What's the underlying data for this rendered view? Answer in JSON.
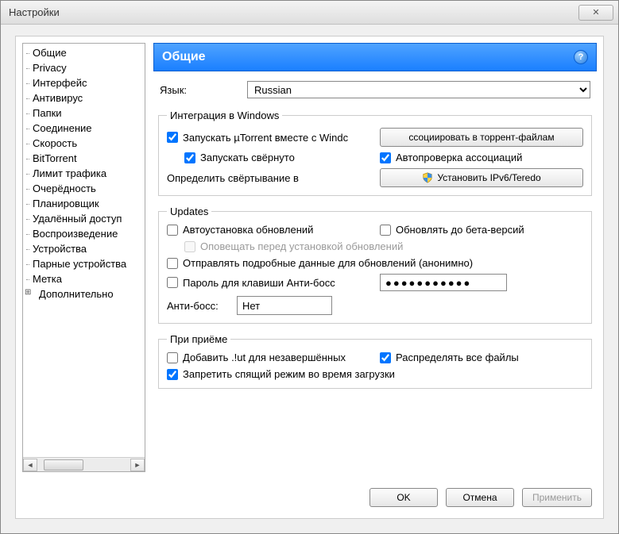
{
  "window": {
    "title": "Настройки"
  },
  "sidebar": {
    "items": [
      {
        "label": "Общие",
        "selected": true
      },
      {
        "label": "Privacy"
      },
      {
        "label": "Интерфейс"
      },
      {
        "label": "Антивирус"
      },
      {
        "label": "Папки"
      },
      {
        "label": "Соединение"
      },
      {
        "label": "Скорость"
      },
      {
        "label": "BitTorrent"
      },
      {
        "label": "Лимит трафика"
      },
      {
        "label": "Очерёдность"
      },
      {
        "label": "Планировщик"
      },
      {
        "label": "Удалённый доступ"
      },
      {
        "label": "Воспроизведение"
      },
      {
        "label": "Устройства"
      },
      {
        "label": "Парные устройства"
      },
      {
        "label": "Метка"
      },
      {
        "label": "Дополнительно",
        "expandable": true
      }
    ]
  },
  "header": {
    "title": "Общие"
  },
  "language": {
    "label": "Язык:",
    "value": "Russian"
  },
  "groups": {
    "windows": {
      "legend": "Интеграция в Windows",
      "startWithWindows": {
        "label": "Запускать µTorrent вместе с Windc",
        "checked": true
      },
      "startMinimized": {
        "label": "Запускать свёрнуто",
        "checked": true
      },
      "assocButton": "ссоциировать в торрент-файлам",
      "autoCheckAssoc": {
        "label": "Автопроверка ассоциаций",
        "checked": true
      },
      "minimizeLabel": "Определить свёртывание в",
      "ipv6Button": "Установить IPv6/Teredo"
    },
    "updates": {
      "legend": "Updates",
      "autoInstall": {
        "label": "Автоустановка обновлений",
        "checked": false
      },
      "betaVersions": {
        "label": "Обновлять до бета-версий",
        "checked": false
      },
      "notifyBefore": {
        "label": "Оповещать перед установкой обновлений",
        "checked": false,
        "disabled": true
      },
      "sendDetails": {
        "label": "Отправлять подробные данные для обновлений (анонимно)",
        "checked": false
      },
      "bossPassword": {
        "label": "Пароль для клавиши Анти-босс",
        "checked": false
      },
      "bossPasswordValue": "●●●●●●●●●●●",
      "bossKeyLabel": "Анти-босс:",
      "bossKeyValue": "Нет"
    },
    "receive": {
      "legend": "При приёме",
      "addUt": {
        "label": "Добавить .!ut для незавершённых",
        "checked": false
      },
      "allocateAll": {
        "label": "Распределять все файлы",
        "checked": true
      },
      "preventSleep": {
        "label": "Запретить спящий режим во время загрузки",
        "checked": true
      }
    }
  },
  "buttons": {
    "ok": "OK",
    "cancel": "Отмена",
    "apply": "Применить"
  }
}
